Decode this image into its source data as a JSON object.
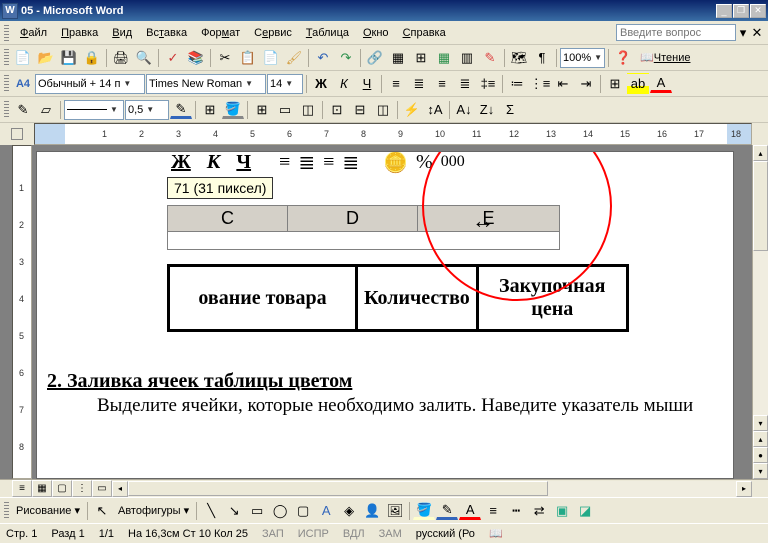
{
  "titlebar": {
    "appIcon": "W",
    "title": "05 - Microsoft Word"
  },
  "menu": {
    "items": [
      {
        "u": "Ф",
        "rest": "айл"
      },
      {
        "u": "П",
        "rest": "равка"
      },
      {
        "u": "В",
        "rest": "ид"
      },
      {
        "u": "т",
        "pre": "Вс",
        "rest": "авка"
      },
      {
        "u": "м",
        "pre": "Фор",
        "rest": "ат"
      },
      {
        "u": "е",
        "pre": "С",
        "rest": "рвис"
      },
      {
        "u": "Т",
        "rest": "аблица"
      },
      {
        "u": "О",
        "rest": "кно"
      },
      {
        "u": "С",
        "rest": "правка"
      }
    ],
    "askPlaceholder": "Введите вопрос"
  },
  "toolbar1": {
    "zoom": "100%",
    "readLabel": "Чтение"
  },
  "toolbar2": {
    "styleIcon": "A4",
    "style": "Обычный + 14 п",
    "font": "Times New Roman",
    "size": "14",
    "bold": "Ж",
    "italic": "К",
    "underline": "Ч"
  },
  "toolbar3": {
    "val1": "0,5",
    "icons": [
      "📄",
      "📑"
    ]
  },
  "document": {
    "excelFmt": [
      "Ж",
      "К",
      "Ч"
    ],
    "tooltip": "71 (31 пиксел)",
    "colHeaders": [
      "C",
      "D",
      "E"
    ],
    "dataCells": [
      "ование товара",
      "Количество",
      "Закупочная цена"
    ],
    "h2": "2. Заливка ячеек таблицы цветом",
    "p": "Выделите ячейки, которые необходимо залить. Наведите указатель мыши"
  },
  "drawbar": {
    "drawLabel": "Рисование",
    "autoshapes": "Автофигуры"
  },
  "status": {
    "page": "Стр. 1",
    "section": "Разд 1",
    "pages": "1/1",
    "pos": "На 16,3см  Ст 10  Кол 25",
    "flags": [
      "ЗАП",
      "ИСПР",
      "ВДЛ",
      "ЗАМ"
    ],
    "lang": "русский (Ро"
  }
}
